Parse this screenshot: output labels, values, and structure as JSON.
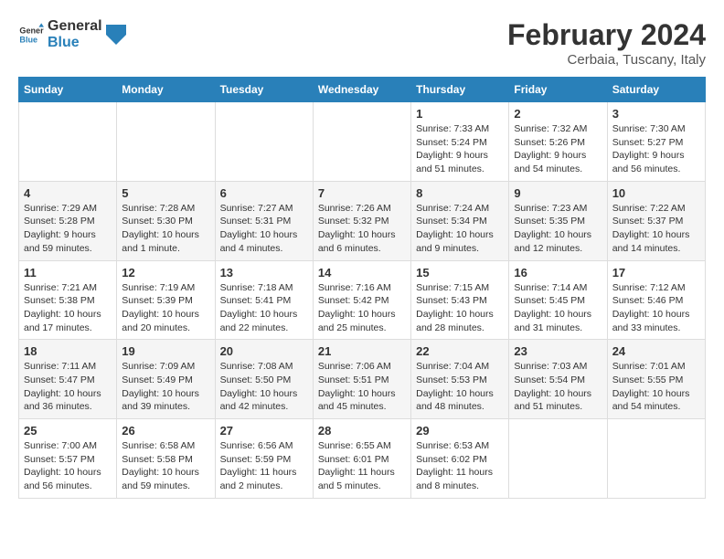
{
  "logo": {
    "text_general": "General",
    "text_blue": "Blue"
  },
  "header": {
    "title": "February 2024",
    "subtitle": "Cerbaia, Tuscany, Italy"
  },
  "days_of_week": [
    "Sunday",
    "Monday",
    "Tuesday",
    "Wednesday",
    "Thursday",
    "Friday",
    "Saturday"
  ],
  "weeks": [
    [
      {
        "day": "",
        "info": ""
      },
      {
        "day": "",
        "info": ""
      },
      {
        "day": "",
        "info": ""
      },
      {
        "day": "",
        "info": ""
      },
      {
        "day": "1",
        "info": "Sunrise: 7:33 AM\nSunset: 5:24 PM\nDaylight: 9 hours and 51 minutes."
      },
      {
        "day": "2",
        "info": "Sunrise: 7:32 AM\nSunset: 5:26 PM\nDaylight: 9 hours and 54 minutes."
      },
      {
        "day": "3",
        "info": "Sunrise: 7:30 AM\nSunset: 5:27 PM\nDaylight: 9 hours and 56 minutes."
      }
    ],
    [
      {
        "day": "4",
        "info": "Sunrise: 7:29 AM\nSunset: 5:28 PM\nDaylight: 9 hours and 59 minutes."
      },
      {
        "day": "5",
        "info": "Sunrise: 7:28 AM\nSunset: 5:30 PM\nDaylight: 10 hours and 1 minute."
      },
      {
        "day": "6",
        "info": "Sunrise: 7:27 AM\nSunset: 5:31 PM\nDaylight: 10 hours and 4 minutes."
      },
      {
        "day": "7",
        "info": "Sunrise: 7:26 AM\nSunset: 5:32 PM\nDaylight: 10 hours and 6 minutes."
      },
      {
        "day": "8",
        "info": "Sunrise: 7:24 AM\nSunset: 5:34 PM\nDaylight: 10 hours and 9 minutes."
      },
      {
        "day": "9",
        "info": "Sunrise: 7:23 AM\nSunset: 5:35 PM\nDaylight: 10 hours and 12 minutes."
      },
      {
        "day": "10",
        "info": "Sunrise: 7:22 AM\nSunset: 5:37 PM\nDaylight: 10 hours and 14 minutes."
      }
    ],
    [
      {
        "day": "11",
        "info": "Sunrise: 7:21 AM\nSunset: 5:38 PM\nDaylight: 10 hours and 17 minutes."
      },
      {
        "day": "12",
        "info": "Sunrise: 7:19 AM\nSunset: 5:39 PM\nDaylight: 10 hours and 20 minutes."
      },
      {
        "day": "13",
        "info": "Sunrise: 7:18 AM\nSunset: 5:41 PM\nDaylight: 10 hours and 22 minutes."
      },
      {
        "day": "14",
        "info": "Sunrise: 7:16 AM\nSunset: 5:42 PM\nDaylight: 10 hours and 25 minutes."
      },
      {
        "day": "15",
        "info": "Sunrise: 7:15 AM\nSunset: 5:43 PM\nDaylight: 10 hours and 28 minutes."
      },
      {
        "day": "16",
        "info": "Sunrise: 7:14 AM\nSunset: 5:45 PM\nDaylight: 10 hours and 31 minutes."
      },
      {
        "day": "17",
        "info": "Sunrise: 7:12 AM\nSunset: 5:46 PM\nDaylight: 10 hours and 33 minutes."
      }
    ],
    [
      {
        "day": "18",
        "info": "Sunrise: 7:11 AM\nSunset: 5:47 PM\nDaylight: 10 hours and 36 minutes."
      },
      {
        "day": "19",
        "info": "Sunrise: 7:09 AM\nSunset: 5:49 PM\nDaylight: 10 hours and 39 minutes."
      },
      {
        "day": "20",
        "info": "Sunrise: 7:08 AM\nSunset: 5:50 PM\nDaylight: 10 hours and 42 minutes."
      },
      {
        "day": "21",
        "info": "Sunrise: 7:06 AM\nSunset: 5:51 PM\nDaylight: 10 hours and 45 minutes."
      },
      {
        "day": "22",
        "info": "Sunrise: 7:04 AM\nSunset: 5:53 PM\nDaylight: 10 hours and 48 minutes."
      },
      {
        "day": "23",
        "info": "Sunrise: 7:03 AM\nSunset: 5:54 PM\nDaylight: 10 hours and 51 minutes."
      },
      {
        "day": "24",
        "info": "Sunrise: 7:01 AM\nSunset: 5:55 PM\nDaylight: 10 hours and 54 minutes."
      }
    ],
    [
      {
        "day": "25",
        "info": "Sunrise: 7:00 AM\nSunset: 5:57 PM\nDaylight: 10 hours and 56 minutes."
      },
      {
        "day": "26",
        "info": "Sunrise: 6:58 AM\nSunset: 5:58 PM\nDaylight: 10 hours and 59 minutes."
      },
      {
        "day": "27",
        "info": "Sunrise: 6:56 AM\nSunset: 5:59 PM\nDaylight: 11 hours and 2 minutes."
      },
      {
        "day": "28",
        "info": "Sunrise: 6:55 AM\nSunset: 6:01 PM\nDaylight: 11 hours and 5 minutes."
      },
      {
        "day": "29",
        "info": "Sunrise: 6:53 AM\nSunset: 6:02 PM\nDaylight: 11 hours and 8 minutes."
      },
      {
        "day": "",
        "info": ""
      },
      {
        "day": "",
        "info": ""
      }
    ]
  ]
}
